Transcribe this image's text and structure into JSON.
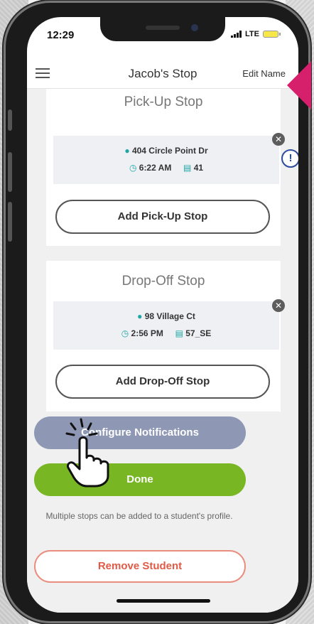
{
  "status_bar": {
    "time": "12:29",
    "network": "LTE"
  },
  "header": {
    "title": "Jacob's Stop",
    "edit_label": "Edit Name"
  },
  "pickup": {
    "title": "Pick-Up Stop",
    "address": "404 Circle Point Dr",
    "time": "6:22 AM",
    "route": "41",
    "add_label": "Add Pick-Up Stop"
  },
  "dropoff": {
    "title": "Drop-Off Stop",
    "address": "98 Village Ct",
    "time": "2:56 PM",
    "route": "57_SE",
    "add_label": "Add Drop-Off Stop"
  },
  "info_glyph": "!",
  "actions": {
    "configure_label": "Configure Notifications",
    "done_label": "Done",
    "note": "Multiple stops can be added to a student's profile.",
    "remove_label": "Remove Student"
  },
  "colors": {
    "accent_teal": "#1ea6a6",
    "done_green": "#79b623",
    "configure_blue": "#8e98b5",
    "remove_red": "#e05a45",
    "arrow_pink": "#d6206b"
  }
}
